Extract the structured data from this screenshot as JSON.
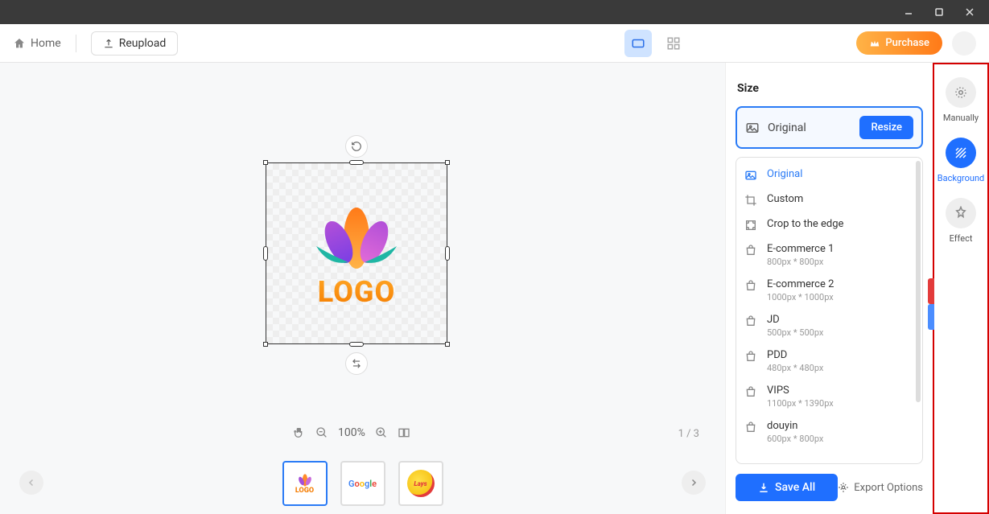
{
  "window": {
    "title": ""
  },
  "toolbar": {
    "home": "Home",
    "reupload": "Reupload",
    "purchase": "Purchase"
  },
  "canvas": {
    "logo_text": "LOGO",
    "zoom": "100%",
    "page_indicator": "1 / 3"
  },
  "thumbnails": [
    {
      "label": "LOGO",
      "active": true
    },
    {
      "label": "Google",
      "active": false
    },
    {
      "label": "Lays",
      "active": false
    }
  ],
  "size_panel": {
    "title": "Size",
    "header_label": "Original",
    "resize_btn": "Resize",
    "presets": [
      {
        "name": "Original",
        "dim": "",
        "selected": true
      },
      {
        "name": "Custom",
        "dim": ""
      },
      {
        "name": "Crop to the edge",
        "dim": ""
      },
      {
        "name": "E-commerce 1",
        "dim": "800px * 800px"
      },
      {
        "name": "E-commerce 2",
        "dim": "1000px * 1000px"
      },
      {
        "name": "JD",
        "dim": "500px * 500px"
      },
      {
        "name": "PDD",
        "dim": "480px * 480px"
      },
      {
        "name": "VIPS",
        "dim": "1100px * 1390px"
      },
      {
        "name": "douyin",
        "dim": "600px * 800px"
      }
    ]
  },
  "side_tabs": {
    "manually": "Manually",
    "background": "Background",
    "effect": "Effect"
  },
  "footer": {
    "save_all": "Save All",
    "export_options": "Export Options"
  },
  "colors": {
    "primary": "#1f6fff",
    "accent_red": "#e33b3b",
    "accent_blue": "#2a7bf6"
  }
}
